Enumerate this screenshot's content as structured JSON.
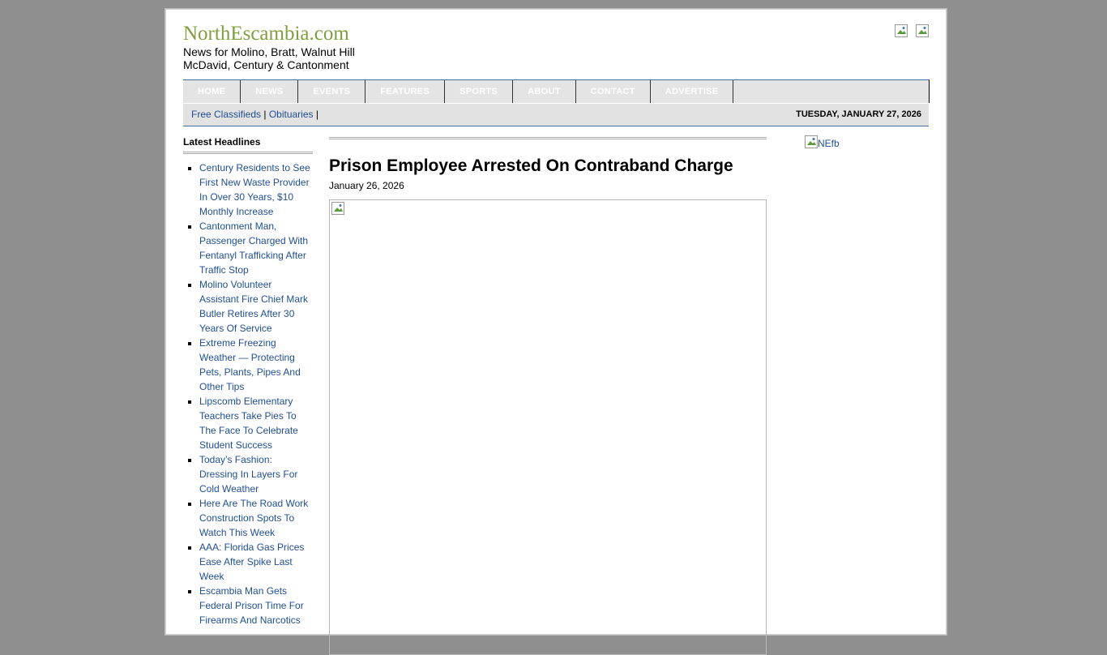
{
  "site": {
    "title": "NorthEscambia.com",
    "tagline_line1": "News for Molino, Bratt, Walnut Hill",
    "tagline_line2": "McDavid, Century & Cantonment",
    "social_icons": [
      "facebook-icon",
      "twitter-icon"
    ]
  },
  "nav": {
    "items": [
      "HOME",
      "NEWS",
      "EVENTS",
      "FEATURES",
      "SPORTS",
      "ABOUT",
      "CONTACT",
      "ADVERTISE"
    ]
  },
  "subbar": {
    "link1": "Free Classifieds",
    "sep1": " | ",
    "link2": "Obituaries",
    "sep2": " |",
    "date": "TUESDAY, JANUARY 27, 2026"
  },
  "sidebar": {
    "heading": "Latest Headlines",
    "headlines": [
      "Century Residents to See First New Waste Provider In Over 30 Years, $10 Monthly Increase",
      "Cantonment Man, Passenger Charged With Fentanyl Trafficking After Traffic Stop",
      "Molino Volunteer Assistant Fire Chief Mark Butler Retires After 30 Years Of Service",
      "Extreme Freezing Weather — Protecting Pets, Plants, Pipes And Other Tips",
      "Lipscomb Elementary Teachers Take Pies To The Face To Celebrate Student Success",
      "Today’s Fashion: Dressing In Layers For Cold Weather",
      "Here Are The Road Work Construction Spots To Watch This Week",
      "AAA: Florida Gas Prices Ease After Spike Last Week",
      "Escambia Man Gets Federal Prison Time For Firearms And Narcotics"
    ]
  },
  "article": {
    "title": "Prison Employee Arrested On Contraband Charge",
    "date": "January 26, 2026"
  },
  "right_ad": {
    "alt_text": "NEfb"
  },
  "colors": {
    "background": "#8f8f8f",
    "site_title": "#7f9f3f",
    "link": "#1f4e93",
    "nav_bg": "#e4e4e4",
    "nav_border": "#456ea3"
  }
}
